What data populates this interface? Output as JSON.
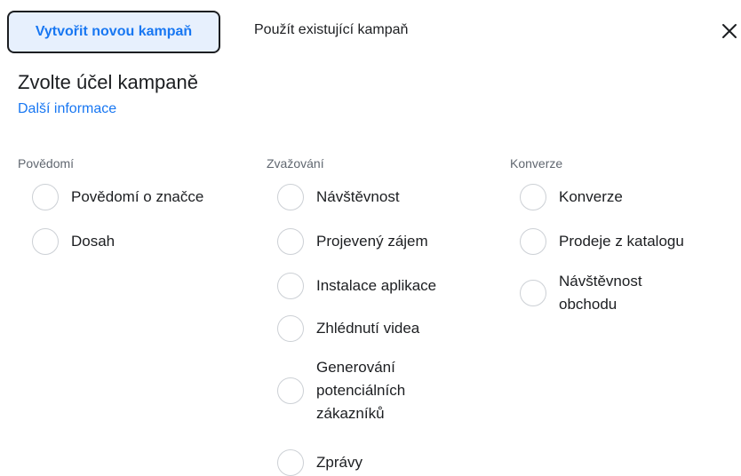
{
  "tabs": {
    "create": "Vytvořit novou kampaň",
    "use_existing": "Použít existující kampaň"
  },
  "title": "Zvolte účel kampaně",
  "learn_more": "Další informace",
  "columns": [
    {
      "heading": "Povědomí",
      "options": [
        "Povědomí o značce",
        "Dosah"
      ]
    },
    {
      "heading": "Zvažování",
      "options": [
        "Návštěvnost",
        "Projevený zájem",
        "Instalace aplikace",
        "Zhlédnutí videa",
        "Generování potenciálních zákazníků",
        "Zprávy"
      ]
    },
    {
      "heading": "Konverze",
      "options": [
        "Konverze",
        "Prodeje z katalogu",
        "Návštěvnost obchodu"
      ]
    }
  ],
  "icons": {
    "close": "close-icon"
  },
  "colors": {
    "accent": "#1877f2",
    "tab_bg": "#e7f0fd"
  }
}
